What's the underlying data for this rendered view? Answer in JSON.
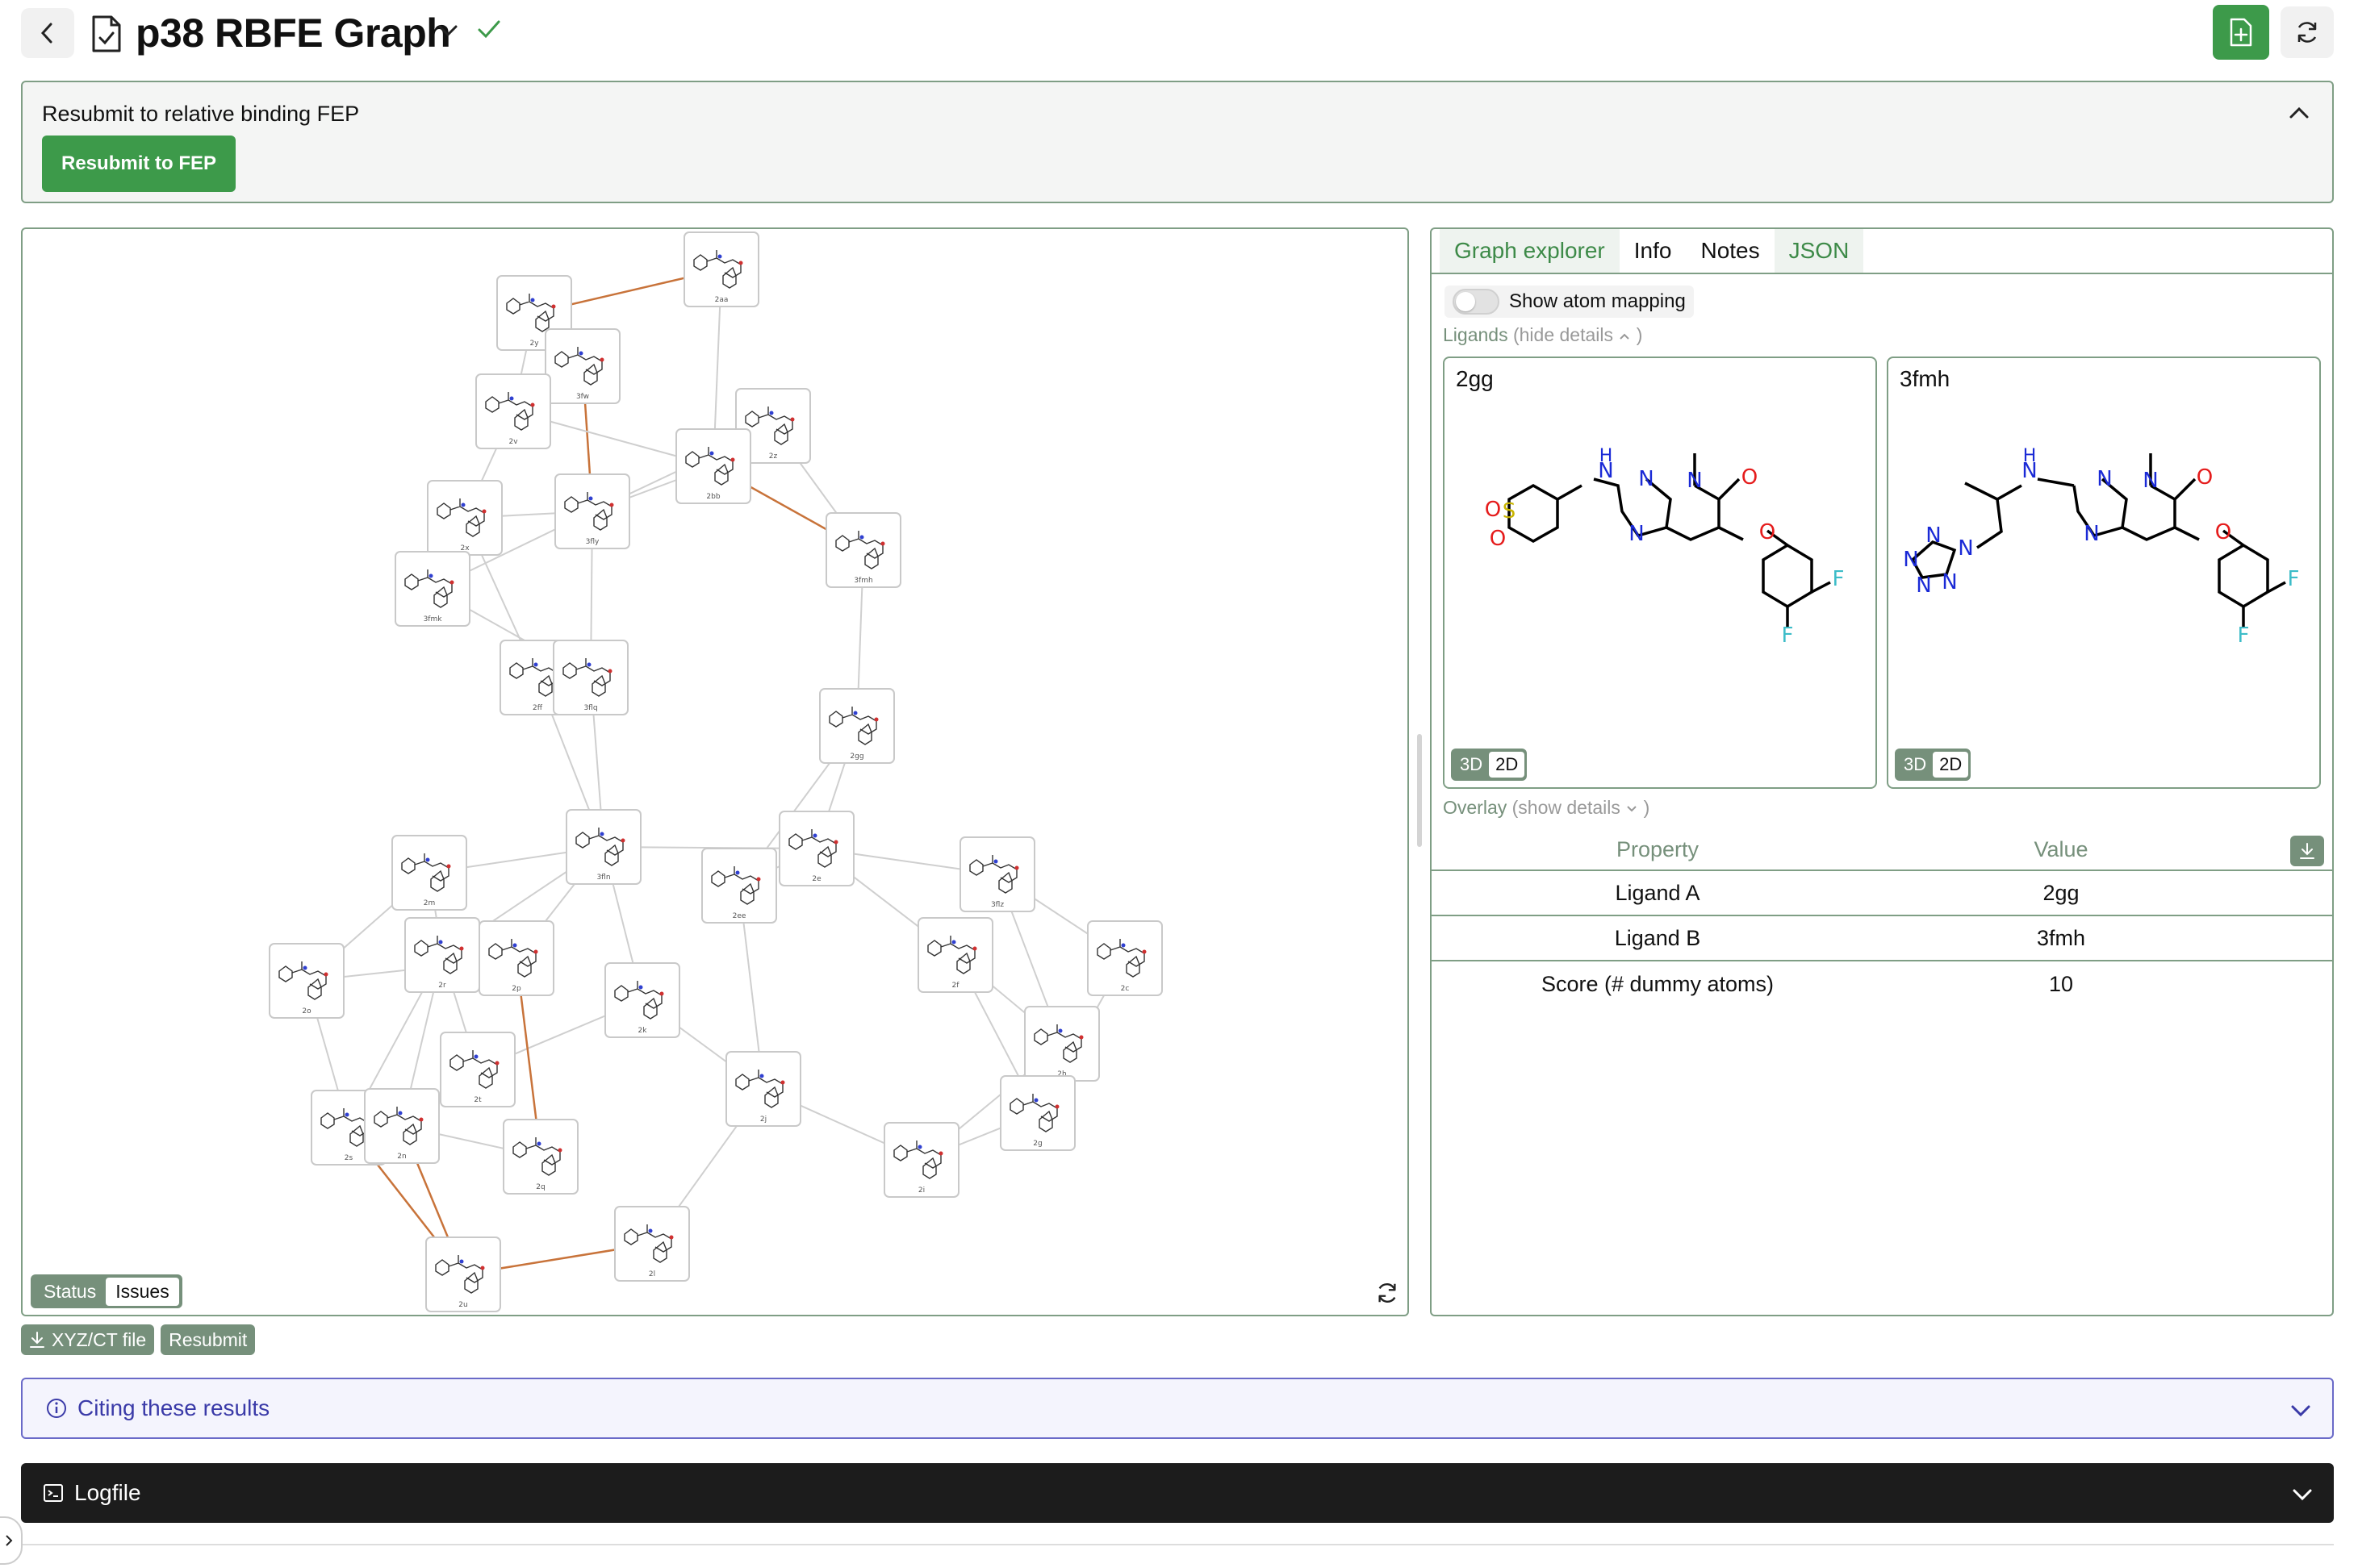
{
  "header": {
    "title": "p38 RBFE Graph",
    "icons": {
      "back": "chevron-left-icon",
      "doc": "document-check-icon",
      "title_menu": "chevron-down-icon",
      "status": "check-icon",
      "export": "file-plus-icon",
      "refresh": "refresh-icon"
    }
  },
  "resubmit": {
    "title": "Resubmit to relative binding FEP",
    "button": "Resubmit to FEP"
  },
  "graph": {
    "toggle": {
      "status": "Status",
      "issues": "Issues",
      "active": "Issues"
    },
    "actions": {
      "download": "XYZ/CT file",
      "resubmit": "Resubmit"
    },
    "nodes": [
      {
        "id": "2aa"
      },
      {
        "id": "2y"
      },
      {
        "id": "3fw"
      },
      {
        "id": "2v"
      },
      {
        "id": "2z"
      },
      {
        "id": "2bb"
      },
      {
        "id": "3fly"
      },
      {
        "id": "2x"
      },
      {
        "id": "3fmh"
      },
      {
        "id": "3fmk"
      },
      {
        "id": "2ff"
      },
      {
        "id": "3flq"
      },
      {
        "id": "2gg"
      },
      {
        "id": "3fln"
      },
      {
        "id": "2e"
      },
      {
        "id": "2m"
      },
      {
        "id": "2ee"
      },
      {
        "id": "3flz"
      },
      {
        "id": "2r"
      },
      {
        "id": "2p"
      },
      {
        "id": "2o"
      },
      {
        "id": "2f"
      },
      {
        "id": "2c"
      },
      {
        "id": "2k"
      },
      {
        "id": "2t"
      },
      {
        "id": "2h"
      },
      {
        "id": "2j"
      },
      {
        "id": "2g"
      },
      {
        "id": "2s"
      },
      {
        "id": "2n"
      },
      {
        "id": "2q"
      },
      {
        "id": "2i"
      },
      {
        "id": "2l"
      },
      {
        "id": "2u"
      }
    ],
    "colors": {
      "normal_edge": "#cfcfcf",
      "issue_edge": "#c8733a"
    }
  },
  "details": {
    "tabs": [
      "Graph explorer",
      "Info",
      "Notes",
      "JSON"
    ],
    "active_tab": "Graph explorer",
    "atom_mapping_label": "Show atom mapping",
    "ligands_label": "Ligands",
    "ligands_link": "(hide details",
    "ligands_link_end": ")",
    "ligand_a": {
      "name": "2gg",
      "view_3d": "3D",
      "view_2d": "2D"
    },
    "ligand_b": {
      "name": "3fmh",
      "view_3d": "3D",
      "view_2d": "2D"
    },
    "overlay_label": "Overlay",
    "overlay_link": "(show details",
    "overlay_link_end": ")",
    "table": {
      "headers": [
        "Property",
        "Value"
      ],
      "rows": [
        {
          "property": "Ligand A",
          "value": "2gg"
        },
        {
          "property": "Ligand B",
          "value": "3fmh"
        },
        {
          "property": "Score (# dummy atoms)",
          "value": "10"
        }
      ]
    }
  },
  "citing": {
    "label": "Citing these results"
  },
  "logfile": {
    "label": "Logfile"
  },
  "colors": {
    "accent": "#3d9a4a",
    "muted_green": "#76907b",
    "border": "#7f9e85",
    "cite": "#3a3aa8"
  }
}
